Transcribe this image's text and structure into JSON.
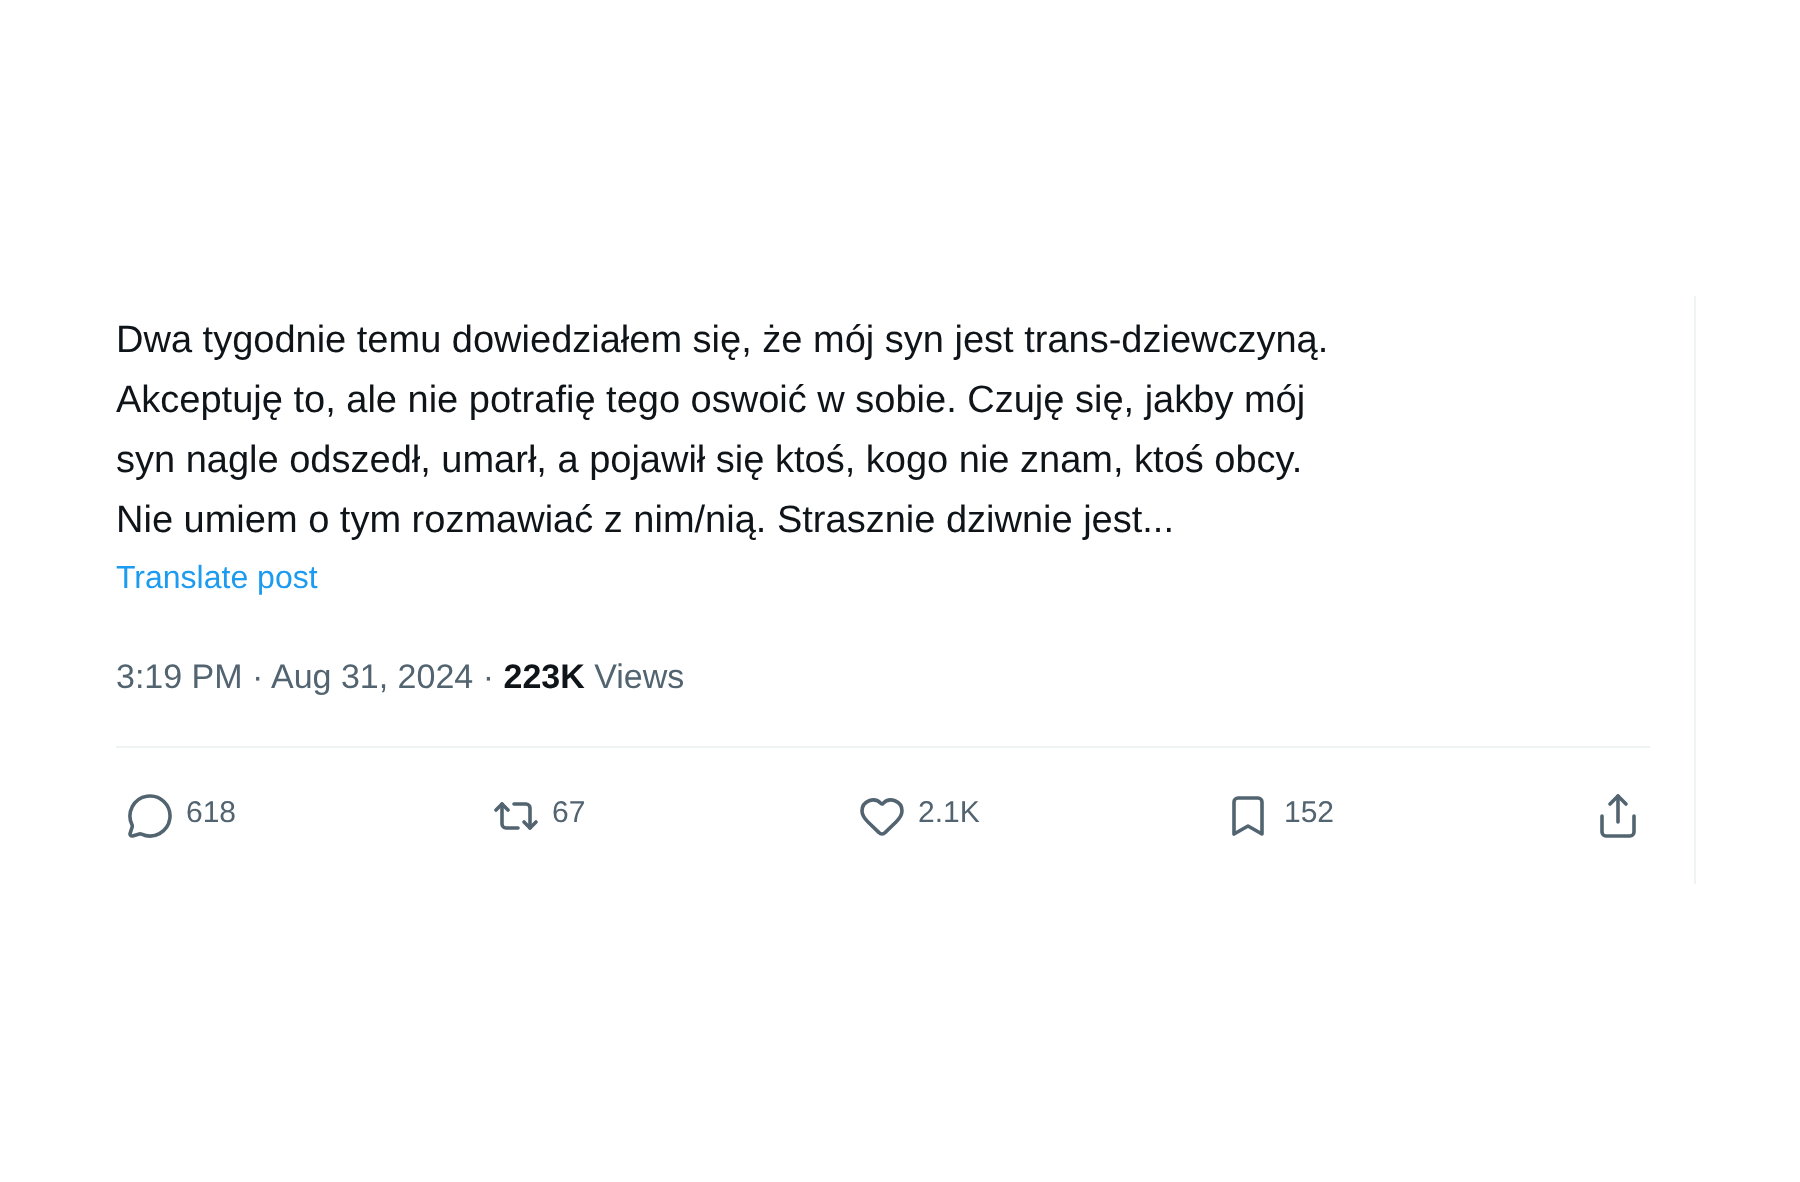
{
  "post": {
    "text_lines": [
      "Dwa tygodnie temu dowiedziałem się, że mój syn jest trans-dziewczyną.",
      "Akceptuję to, ale nie potrafię tego oswoić w sobie. Czuję się, jakby mój",
      "syn nagle odszedł, umarł, a pojawił się ktoś, kogo nie znam, ktoś obcy.",
      "Nie umiem o tym rozmawiać z nim/nią. Strasznie dziwnie jest..."
    ],
    "translate_link": "Translate post",
    "meta": "3:19 PM · Aug 31, 2024 · **223K** Views",
    "actions": [
      {
        "kind": "reply",
        "count": "618"
      },
      {
        "kind": "repost",
        "count": "67"
      },
      {
        "kind": "like",
        "count": "2.1K"
      },
      {
        "kind": "bookmark",
        "count": "152"
      },
      {
        "kind": "share"
      }
    ]
  }
}
